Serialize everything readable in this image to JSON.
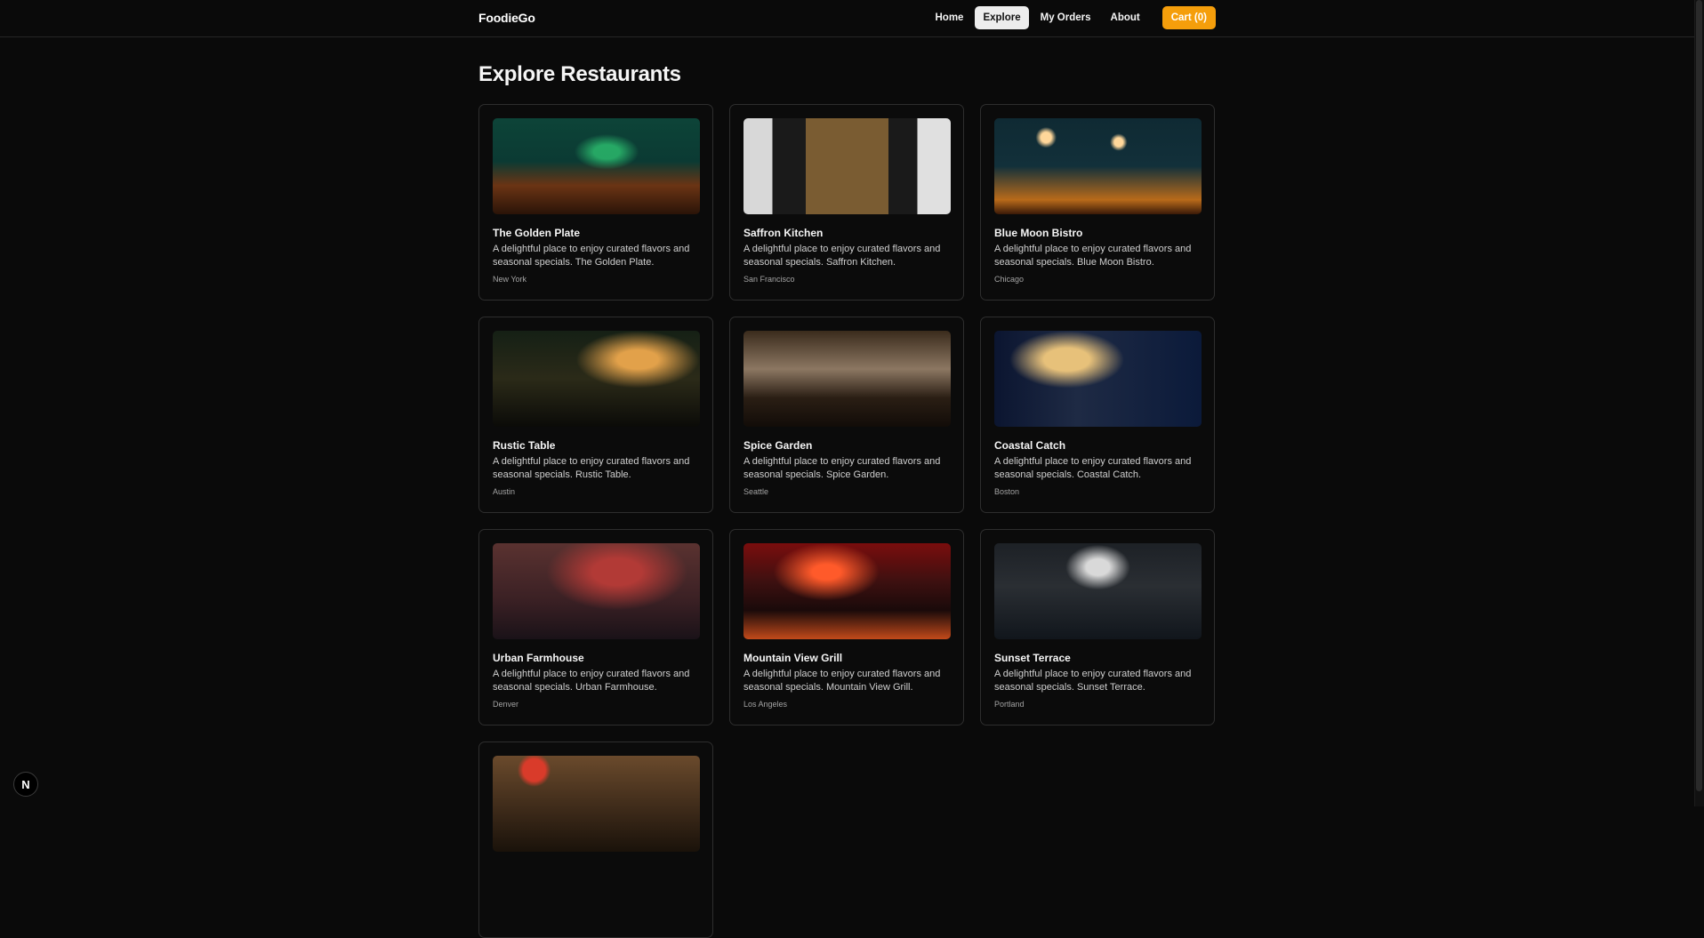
{
  "nav": {
    "brand": "FoodieGo",
    "links": [
      {
        "label": "Home",
        "active": false
      },
      {
        "label": "Explore",
        "active": true
      },
      {
        "label": "My Orders",
        "active": false
      },
      {
        "label": "About",
        "active": false
      }
    ],
    "cart_label": "Cart (0)"
  },
  "page": {
    "title": "Explore Restaurants"
  },
  "restaurants": [
    {
      "name": "The Golden Plate",
      "description": "A delightful place to enjoy curated flavors and seasonal specials. The Golden Plate.",
      "city": "New York"
    },
    {
      "name": "Saffron Kitchen",
      "description": "A delightful place to enjoy curated flavors and seasonal specials. Saffron Kitchen.",
      "city": "San Francisco"
    },
    {
      "name": "Blue Moon Bistro",
      "description": "A delightful place to enjoy curated flavors and seasonal specials. Blue Moon Bistro.",
      "city": "Chicago"
    },
    {
      "name": "Rustic Table",
      "description": "A delightful place to enjoy curated flavors and seasonal specials. Rustic Table.",
      "city": "Austin"
    },
    {
      "name": "Spice Garden",
      "description": "A delightful place to enjoy curated flavors and seasonal specials. Spice Garden.",
      "city": "Seattle"
    },
    {
      "name": "Coastal Catch",
      "description": "A delightful place to enjoy curated flavors and seasonal specials. Coastal Catch.",
      "city": "Boston"
    },
    {
      "name": "Urban Farmhouse",
      "description": "A delightful place to enjoy curated flavors and seasonal specials. Urban Farmhouse.",
      "city": "Denver"
    },
    {
      "name": "Mountain View Grill",
      "description": "A delightful place to enjoy curated flavors and seasonal specials. Mountain View Grill.",
      "city": "Los Angeles"
    },
    {
      "name": "Sunset Terrace",
      "description": "A delightful place to enjoy curated flavors and seasonal specials. Sunset Terrace.",
      "city": "Portland"
    },
    {
      "name": "",
      "description": "",
      "city": ""
    }
  ],
  "badge": {
    "icon": "nextjs-icon",
    "glyph": "N"
  },
  "colors": {
    "background": "#0a0a0a",
    "accent": "#f59e0b",
    "active_nav_bg": "#ededed",
    "card_border": "#2e2e2e"
  }
}
